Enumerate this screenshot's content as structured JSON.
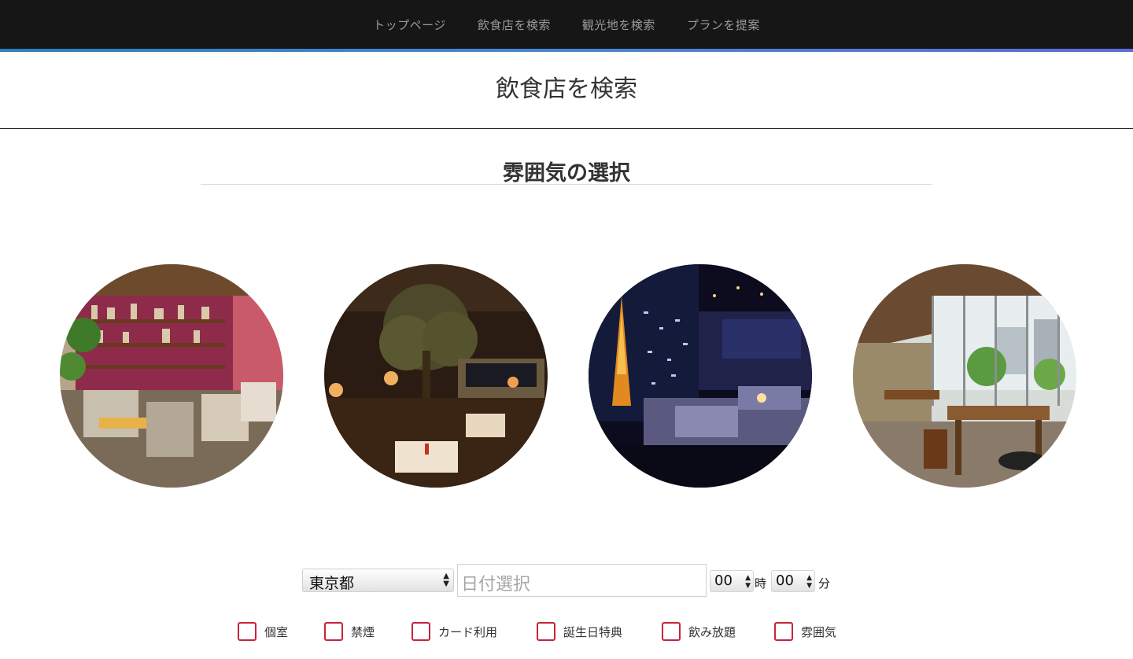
{
  "nav": {
    "items": [
      "トップページ",
      "飲食店を検索",
      "観光地を検索",
      "プランを提案"
    ]
  },
  "page": {
    "title": "飲食店を検索"
  },
  "atmosphere": {
    "title": "雰囲気の選択",
    "options": [
      {
        "name": "cafe-lounge"
      },
      {
        "name": "dim-restaurant"
      },
      {
        "name": "night-view-bar"
      },
      {
        "name": "terrace-dining"
      }
    ]
  },
  "search": {
    "prefecture": "東京都",
    "date_placeholder": "日付選択",
    "hour": "00",
    "hour_unit": "時",
    "minute": "00",
    "minute_unit": "分"
  },
  "filters": [
    "個室",
    "禁煙",
    "カード利用",
    "誕生日特典",
    "飲み放題",
    "雰囲気"
  ],
  "colors": {
    "nav_bg": "#161616",
    "accent": "#4a86d0",
    "checkbox_border": "#c8243a"
  }
}
